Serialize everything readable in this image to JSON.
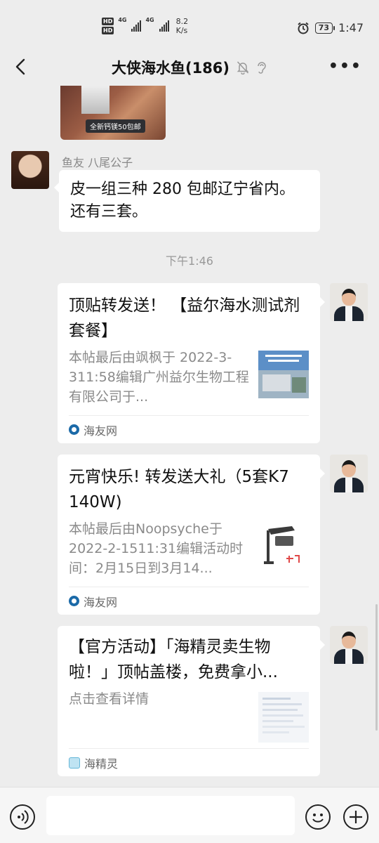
{
  "status_bar": {
    "hd1": "HD",
    "hd2": "HD",
    "net1": "4G",
    "net2": "4G",
    "speed_value": "8.2",
    "speed_unit": "K/s",
    "battery": "73",
    "time": "1:47"
  },
  "header": {
    "title": "大侠海水鱼(186)"
  },
  "chat": {
    "image_banner": "全新钙镁50包邮",
    "msg1": {
      "sender": "鱼友 八尾公子",
      "text": "皮一组三种 280 包邮辽宁省内。还有三套。"
    },
    "timestamp": "下午1:46",
    "card1": {
      "title": "顶贴转发送！ 【益尔海水测试剂套餐】",
      "desc": "本帖最后由飒枫于 2022-3-311:58编辑广州益尔生物工程有限公司于...",
      "source": "海友网"
    },
    "card2": {
      "title": "元宵快乐! 转发送大礼（5套K7 140W)",
      "desc": "本帖最后由Noopsyche于2022-2-1511:31编辑活动时间：2月15日到3月14...",
      "source": "海友网"
    },
    "card3": {
      "title": "【官方活动】「海精灵卖生物啦！」顶帖盖楼，免费拿小...",
      "desc": "点击查看详情",
      "source": "海精灵"
    }
  },
  "colors": {
    "background": "#ededed",
    "bubble": "#ffffff",
    "meta_text": "#999999"
  }
}
